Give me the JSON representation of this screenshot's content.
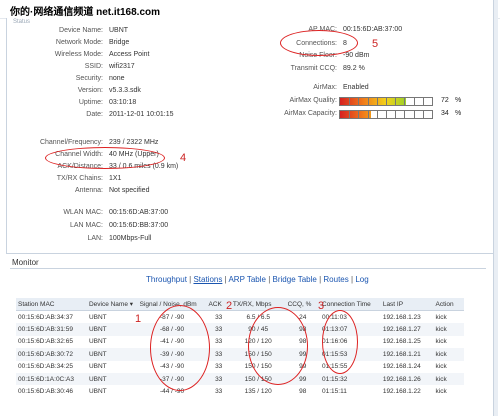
{
  "watermark": {
    "text": "你的·网络通信频道 net.it168.com"
  },
  "page_hint": "Status",
  "device": {
    "rows": [
      {
        "label": "Device Name:",
        "value": "UBNT"
      },
      {
        "label": "Network Mode:",
        "value": "Bridge"
      },
      {
        "label": "Wireless Mode:",
        "value": "Access Point"
      },
      {
        "label": "SSID:",
        "value": "wifi2317"
      },
      {
        "label": "Security:",
        "value": "none"
      },
      {
        "label": "Version:",
        "value": "v5.3.3.sdk"
      },
      {
        "label": "Uptime:",
        "value": "03:10:18"
      },
      {
        "label": "Date:",
        "value": "2011-12-01 10:01:15"
      }
    ],
    "rows2": [
      {
        "label": "Channel/Frequency:",
        "value": "239 / 2322 MHz"
      },
      {
        "label": "Channel Width:",
        "value": "40 MHz (Upper)"
      },
      {
        "label": "ACK/Distance:",
        "value": "33 / 0.6 miles (0.9 km)"
      },
      {
        "label": "TX/RX Chains:",
        "value": "1X1"
      },
      {
        "label": "Antenna:",
        "value": "Not specified"
      }
    ],
    "rows3": [
      {
        "label": "WLAN MAC:",
        "value": "00:15:6D:AB:37:00"
      },
      {
        "label": "LAN MAC:",
        "value": "00:15:6D:BB:37:00"
      },
      {
        "label": "LAN:",
        "value": "100Mbps-Full"
      }
    ]
  },
  "right": {
    "ap_mac_label": "AP MAC:",
    "ap_mac_value": "00:15:6D:AB:37:00",
    "connections_label": "Connections:",
    "connections_value": "8",
    "noise_label": "Noise Floor:",
    "noise_value": "-90 dBm",
    "ccq_label": "Transmit CCQ:",
    "ccq_value": "89.2 %",
    "airmax_label": "AirMax:",
    "airmax_value": "Enabled",
    "quality_label": "AirMax Quality:",
    "quality_value": "72",
    "quality_pct": "%",
    "quality_level": 0.72,
    "capacity_label": "AirMax Capacity:",
    "capacity_value": "34",
    "capacity_pct": "%",
    "capacity_level": 0.34
  },
  "annotations": {
    "n1": "1",
    "n2": "2",
    "n3": "3",
    "n4": "4",
    "n5": "5"
  },
  "monitor": {
    "title": "Monitor",
    "tabs": [
      {
        "label": "Throughput",
        "selected": false
      },
      {
        "label": "Stations",
        "selected": true
      },
      {
        "label": "ARP Table",
        "selected": false
      },
      {
        "label": "Bridge Table",
        "selected": false
      },
      {
        "label": "Routes",
        "selected": false
      },
      {
        "label": "Log",
        "selected": false
      }
    ]
  },
  "stations": {
    "headers": [
      "Station MAC",
      "Device Name ▾",
      "Signal / Noise, dBm",
      "ACK",
      "TX/RX, Mbps",
      "CCQ, %",
      "Connection Time",
      "Last IP",
      "Action"
    ],
    "rows": [
      [
        "00:15:6D:AB:34:37",
        "UBNT",
        "-87 / -90",
        "33",
        "6.5 / 6.5",
        "24",
        "00:11:03",
        "192.168.1.23",
        "kick"
      ],
      [
        "00:15:6D:AB:31:59",
        "UBNT",
        "-68 / -90",
        "33",
        "90 / 45",
        "98",
        "01:13:07",
        "192.168.1.27",
        "kick"
      ],
      [
        "00:15:6D:AB:32:65",
        "UBNT",
        "-41 / -90",
        "33",
        "120 / 120",
        "98",
        "01:16:06",
        "192.168.1.25",
        "kick"
      ],
      [
        "00:15:6D:AB:30:72",
        "UBNT",
        "-39 / -90",
        "33",
        "150 / 150",
        "99",
        "01:15:53",
        "192.168.1.21",
        "kick"
      ],
      [
        "00:15:6D:AB:34:25",
        "UBNT",
        "-43 / -90",
        "33",
        "150 / 150",
        "99",
        "01:15:55",
        "192.168.1.24",
        "kick"
      ],
      [
        "00:15:6D:1A:0C:A3",
        "UBNT",
        "-37 / -90",
        "33",
        "150 / 150",
        "99",
        "01:15:32",
        "192.168.1.26",
        "kick"
      ],
      [
        "00:15:6D:AB:30:46",
        "UBNT",
        "-44 / -90",
        "33",
        "135 / 120",
        "98",
        "01:15:11",
        "192.168.1.22",
        "kick"
      ]
    ]
  }
}
